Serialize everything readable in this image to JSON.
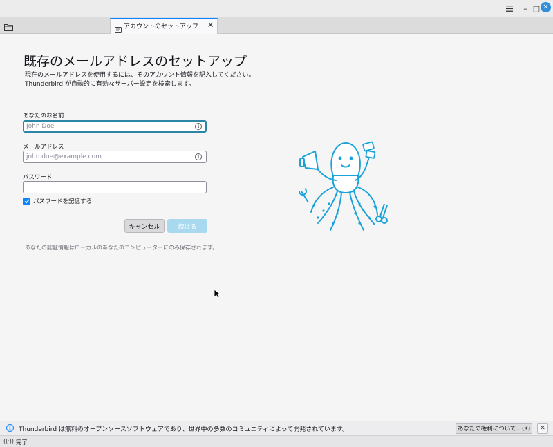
{
  "window": {
    "menu_icon": "hamburger-icon",
    "min_glyph": "–",
    "max_glyph": "□",
    "close_glyph": "✕"
  },
  "tabs": [
    {
      "label": "アカウントのセットアップ",
      "close_glyph": "✕",
      "icon": "mail-icon"
    }
  ],
  "main": {
    "title": "既存のメールアドレスのセットアップ",
    "description_line1": "現在のメールアドレスを使用するには、そのアカウント情報を記入してください。",
    "description_line2": "Thunderbird が自動的に有効なサーバー設定を検索します。",
    "name_field": {
      "label": "あなたのお名前",
      "placeholder": "John Doe",
      "value": ""
    },
    "email_field": {
      "label": "メールアドレス",
      "placeholder": "john.doe@example.com",
      "value": ""
    },
    "password_field": {
      "label": "パスワード",
      "value": ""
    },
    "remember_password": {
      "label": "パスワードを記憶する",
      "checked": true
    },
    "cancel_label": "キャンセル",
    "continue_label": "続ける",
    "privacy_note": "あなたの認証情報はローカルのあなたのコンピューターにのみ保存されます。",
    "info_glyph": "i"
  },
  "notification": {
    "text": "Thunderbird は無料のオープンソースソフトウェアであり、世界中の多数のコミュニティによって開発されています。",
    "rights_button": "あなたの権利について…(K)",
    "close_glyph": "✕",
    "info_glyph": "i"
  },
  "status": {
    "icon_glyph": "((·))",
    "text": "完了"
  },
  "colors": {
    "accent": "#0a84ff",
    "focus_border": "#2c86a5",
    "continue_disabled": "#a8d9ef",
    "mascot": "#1aa3d9"
  }
}
